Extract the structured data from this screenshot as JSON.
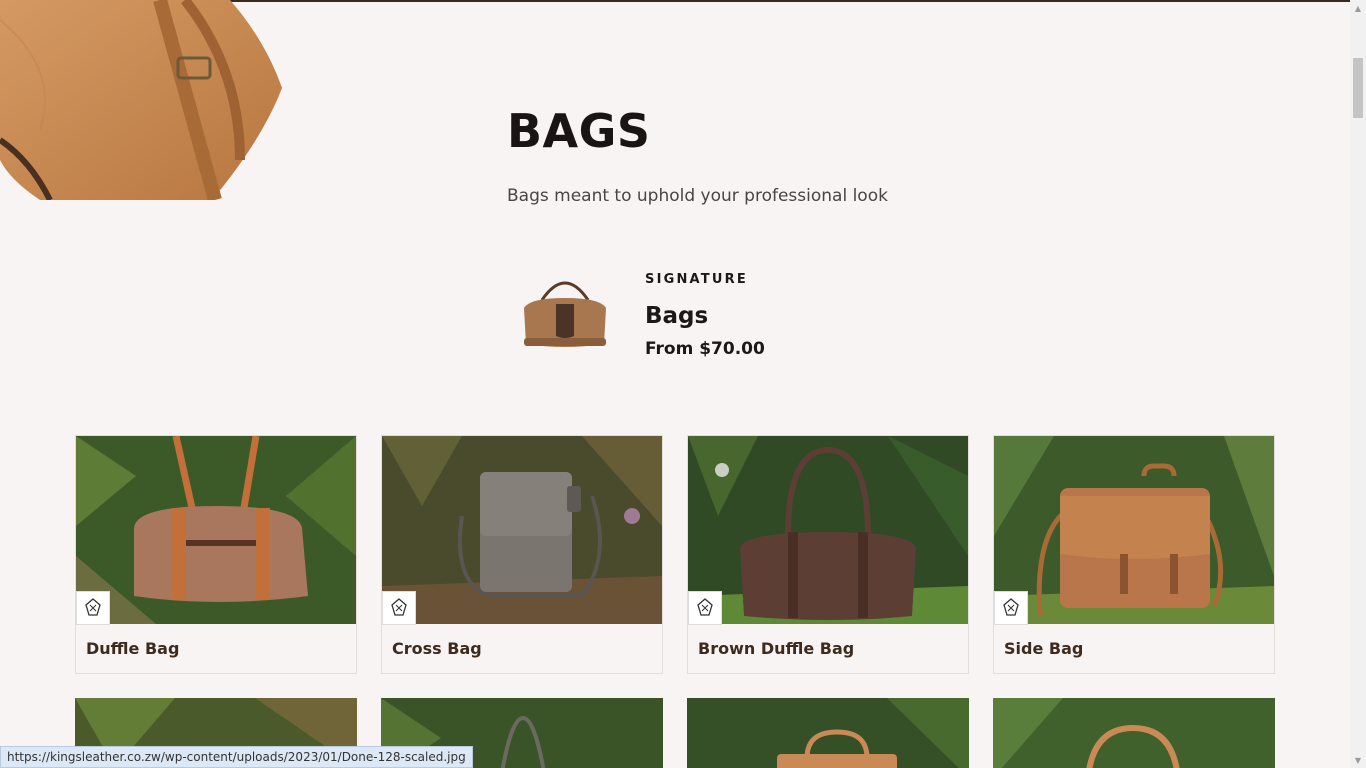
{
  "hero": {
    "title": "BAGS",
    "subtitle": "Bags meant to uphold your professional look"
  },
  "signature": {
    "eyebrow": "SIGNATURE",
    "title": "Bags",
    "price": "From $70.00"
  },
  "products": [
    {
      "name": "Duffle Bag",
      "color": "#b57a55"
    },
    {
      "name": "Cross Bag",
      "color": "#7b7570"
    },
    {
      "name": "Brown Duffle Bag",
      "color": "#5d3e34"
    },
    {
      "name": "Side Bag",
      "color": "#b8764a"
    }
  ],
  "status_bar": {
    "url": "https://kingsleather.co.zw/wp-content/uploads/2023/01/Done-128-scaled.jpg"
  },
  "colors": {
    "background": "#f8f4f3",
    "leather": "#c98a55",
    "foliage": "#3f5a2a"
  }
}
